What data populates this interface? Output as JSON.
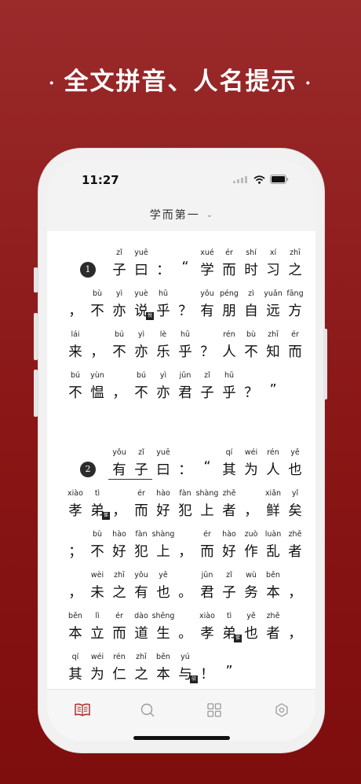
{
  "headline": {
    "dot_left": "·",
    "text": "全文拼音、人名提示",
    "dot_right": "·"
  },
  "status": {
    "time": "11:27"
  },
  "nav": {
    "title": "学而第一",
    "chevron": "⌄"
  },
  "colors": {
    "accent": "#8a1616",
    "tab_active": "#b2322f",
    "tab_inactive": "#9a9a9a"
  },
  "passages": [
    {
      "number": "1",
      "lines": [
        [
          {
            "c": "子",
            "p": "zǐ"
          },
          {
            "c": "曰",
            "p": "yuē"
          },
          {
            "c": "：",
            "p": ""
          },
          {
            "c": "“",
            "p": ""
          },
          {
            "c": "学",
            "p": "xué"
          },
          {
            "c": "而",
            "p": "ér"
          },
          {
            "c": "时",
            "p": "shí"
          },
          {
            "c": "习",
            "p": "xí"
          },
          {
            "c": "之",
            "p": "zhī"
          }
        ],
        [
          {
            "c": "，",
            "p": ""
          },
          {
            "c": "不",
            "p": "bù"
          },
          {
            "c": "亦",
            "p": "yì"
          },
          {
            "c": "说",
            "p": "yuè",
            "note": "悦"
          },
          {
            "c": "乎",
            "p": "hū"
          },
          {
            "c": "？",
            "p": ""
          },
          {
            "c": "有",
            "p": "yǒu"
          },
          {
            "c": "朋",
            "p": "péng"
          },
          {
            "c": "自",
            "p": "zì"
          },
          {
            "c": "远",
            "p": "yuǎn"
          },
          {
            "c": "方",
            "p": "fāng"
          }
        ],
        [
          {
            "c": "来",
            "p": "lái"
          },
          {
            "c": "，",
            "p": ""
          },
          {
            "c": "不",
            "p": "bú"
          },
          {
            "c": "亦",
            "p": "yì"
          },
          {
            "c": "乐",
            "p": "lè"
          },
          {
            "c": "乎",
            "p": "hū"
          },
          {
            "c": "？",
            "p": ""
          },
          {
            "c": "人",
            "p": "rén"
          },
          {
            "c": "不",
            "p": "bù"
          },
          {
            "c": "知",
            "p": "zhī"
          },
          {
            "c": "而",
            "p": "ér"
          }
        ],
        [
          {
            "c": "不",
            "p": "bú"
          },
          {
            "c": "愠",
            "p": "yùn"
          },
          {
            "c": "，",
            "p": ""
          },
          {
            "c": "不",
            "p": "bú"
          },
          {
            "c": "亦",
            "p": "yì"
          },
          {
            "c": "君",
            "p": "jūn"
          },
          {
            "c": "子",
            "p": "zǐ"
          },
          {
            "c": "乎",
            "p": "hū"
          },
          {
            "c": "？",
            "p": ""
          },
          {
            "c": "”",
            "p": ""
          }
        ]
      ]
    },
    {
      "number": "2",
      "lines": [
        [
          {
            "c": "有",
            "p": "yǒu"
          },
          {
            "c": "子",
            "p": "zǐ"
          },
          {
            "c": "曰",
            "p": "yuē"
          },
          {
            "c": "：",
            "p": ""
          },
          {
            "c": "“",
            "p": ""
          },
          {
            "c": "其",
            "p": "qí"
          },
          {
            "c": "为",
            "p": "wéi"
          },
          {
            "c": "人",
            "p": "rén"
          },
          {
            "c": "也",
            "p": "yě"
          }
        ],
        [
          {
            "c": "孝",
            "p": "xiào"
          },
          {
            "c": "弟",
            "p": "tì",
            "note": "悌"
          },
          {
            "c": "，",
            "p": ""
          },
          {
            "c": "而",
            "p": "ér"
          },
          {
            "c": "好",
            "p": "hào"
          },
          {
            "c": "犯",
            "p": "fàn"
          },
          {
            "c": "上",
            "p": "shàng"
          },
          {
            "c": "者",
            "p": "zhě"
          },
          {
            "c": "，",
            "p": ""
          },
          {
            "c": "鲜",
            "p": "xiǎn"
          },
          {
            "c": "矣",
            "p": "yǐ"
          }
        ],
        [
          {
            "c": "；",
            "p": ""
          },
          {
            "c": "不",
            "p": "bù"
          },
          {
            "c": "好",
            "p": "hào"
          },
          {
            "c": "犯",
            "p": "fàn"
          },
          {
            "c": "上",
            "p": "shàng"
          },
          {
            "c": "，",
            "p": ""
          },
          {
            "c": "而",
            "p": "ér"
          },
          {
            "c": "好",
            "p": "hào"
          },
          {
            "c": "作",
            "p": "zuò"
          },
          {
            "c": "乱",
            "p": "luàn"
          },
          {
            "c": "者",
            "p": "zhě"
          }
        ],
        [
          {
            "c": "，",
            "p": ""
          },
          {
            "c": "未",
            "p": "wèi"
          },
          {
            "c": "之",
            "p": "zhī"
          },
          {
            "c": "有",
            "p": "yǒu"
          },
          {
            "c": "也",
            "p": "yě"
          },
          {
            "c": "。",
            "p": ""
          },
          {
            "c": "君",
            "p": "jūn"
          },
          {
            "c": "子",
            "p": "zǐ"
          },
          {
            "c": "务",
            "p": "wù"
          },
          {
            "c": "本",
            "p": "běn"
          },
          {
            "c": "，",
            "p": ""
          }
        ],
        [
          {
            "c": "本",
            "p": "běn"
          },
          {
            "c": "立",
            "p": "lì"
          },
          {
            "c": "而",
            "p": "ér"
          },
          {
            "c": "道",
            "p": "dào"
          },
          {
            "c": "生",
            "p": "shēng"
          },
          {
            "c": "。",
            "p": ""
          },
          {
            "c": "孝",
            "p": "xiào"
          },
          {
            "c": "弟",
            "p": "tì",
            "note": "悌"
          },
          {
            "c": "也",
            "p": "yě"
          },
          {
            "c": "者",
            "p": "zhě"
          },
          {
            "c": "，",
            "p": ""
          }
        ],
        [
          {
            "c": "其",
            "p": "qí"
          },
          {
            "c": "为",
            "p": "wéi"
          },
          {
            "c": "仁",
            "p": "rén"
          },
          {
            "c": "之",
            "p": "zhī"
          },
          {
            "c": "本",
            "p": "běn"
          },
          {
            "c": "与",
            "p": "yú",
            "note": "欤"
          },
          {
            "c": "！",
            "p": ""
          },
          {
            "c": "”",
            "p": ""
          }
        ]
      ]
    }
  ],
  "tabs": [
    {
      "name": "tab-read",
      "icon": "book-icon",
      "active": true
    },
    {
      "name": "tab-search",
      "icon": "search-icon",
      "active": false
    },
    {
      "name": "tab-catalog",
      "icon": "grid-icon",
      "active": false
    },
    {
      "name": "tab-settings",
      "icon": "gear-icon",
      "active": false
    }
  ]
}
